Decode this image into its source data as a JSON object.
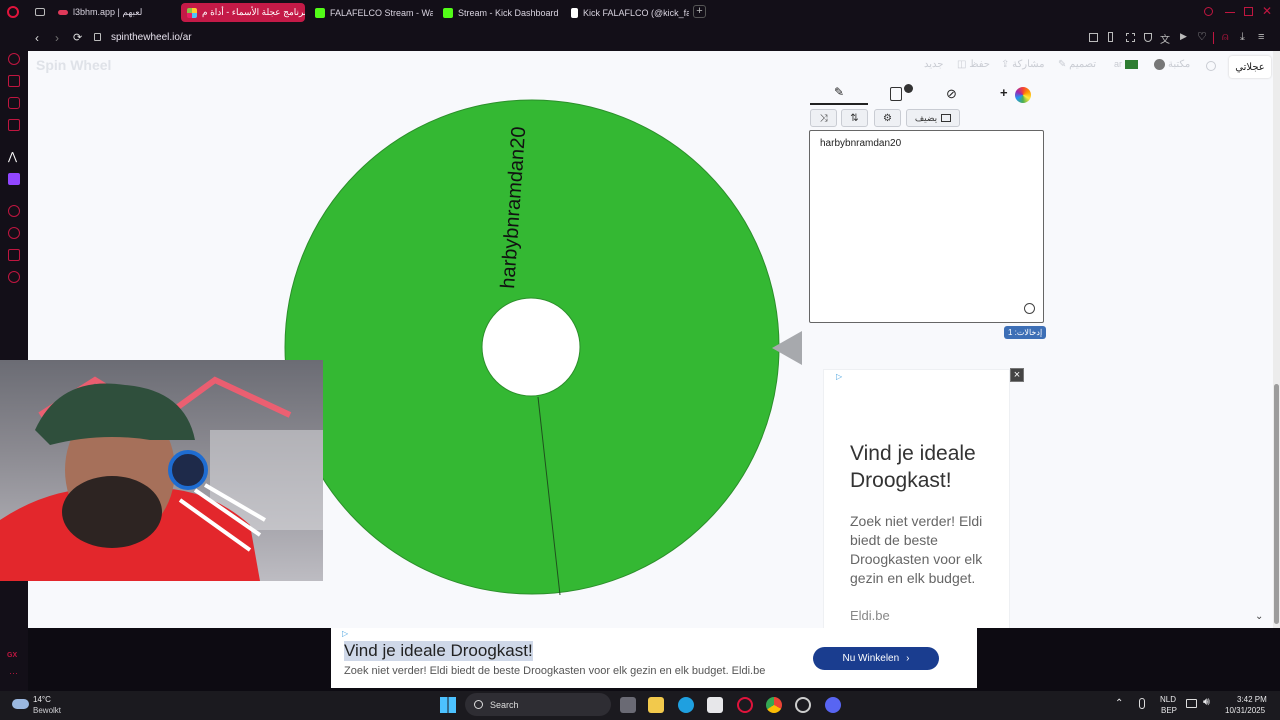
{
  "tabs": [
    {
      "title": "l3bhm.app | لعبهم",
      "color": "#e03a5a"
    },
    {
      "title": "برنامج عجلة الأسماء - أداة م...",
      "color": "#ffcc33"
    },
    {
      "title": "FALAFELCO Stream - Wa",
      "color": "#53fc18"
    },
    {
      "title": "Stream - Kick Dashboard",
      "color": "#53fc18"
    },
    {
      "title": "Kick FALAFLCO (@kick_fa",
      "color": "#ffffff"
    }
  ],
  "address": {
    "url": "spinthewheel.io/ar"
  },
  "site": {
    "logo": "Spin Wheel",
    "nav": [
      "عجلاتي",
      "مكتبة",
      "ar",
      "تصميم",
      "مشاركة",
      "حفظ",
      "جديد"
    ]
  },
  "editor": {
    "add_label": "يضيف",
    "entries_text": "harbybnramdan20",
    "count_badge": "إدخالات: 1",
    "emoji_icon": "smiley-icon"
  },
  "wheel": {
    "segments": [
      {
        "label": "harbybnramdan20",
        "color": "#34b833"
      }
    ],
    "bg": "#34b833"
  },
  "ad_side": {
    "title": "Vind je ideale Droogkast!",
    "body": "Zoek niet verder! Eldi biedt de beste Droogkasten voor elk gezin en elk budget.",
    "source": "Eldi.be"
  },
  "ad_bottom": {
    "title": "Vind je ideale Droogkast!",
    "body": "Zoek niet verder! Eldi biedt de beste Droogkasten voor elk gezin en elk budget. Eldi.be",
    "cta": "Nu Winkelen"
  },
  "taskbar": {
    "weather_temp": "14°C",
    "weather_desc": "Bewolkt",
    "search": "Search",
    "lang1": "NLD",
    "lang2": "BEP",
    "time": "3:42 PM",
    "date": "10/31/2025"
  }
}
